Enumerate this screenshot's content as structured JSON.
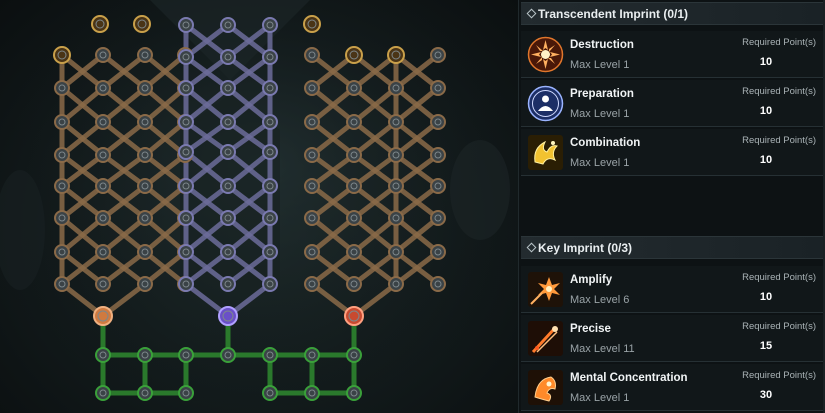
{
  "colors": {
    "orange_branch": "#8a6a48",
    "purple_branch": "#6c6c9a",
    "green_branch": "#2f8a2f",
    "node_fill": "#3a4246",
    "panel_bg": "#0d1214"
  },
  "tree": {
    "description_icons": [
      "node-orange-icon",
      "node-purple-icon",
      "node-green-icon"
    ]
  },
  "transcendent": {
    "title": "Transcendent Imprint (0/1)",
    "items": [
      {
        "name": "Destruction",
        "level": "Max Level 1",
        "req_label": "Required Point(s)",
        "points": "10",
        "icon": "destruction-icon"
      },
      {
        "name": "Preparation",
        "level": "Max Level 1",
        "req_label": "Required Point(s)",
        "points": "10",
        "icon": "preparation-icon"
      },
      {
        "name": "Combination",
        "level": "Max Level 1",
        "req_label": "Required Point(s)",
        "points": "10",
        "icon": "combination-icon"
      }
    ]
  },
  "key": {
    "title": "Key Imprint (0/3)",
    "items": [
      {
        "name": "Amplify",
        "level": "Max Level 6",
        "req_label": "Required Point(s)",
        "points": "10",
        "icon": "amplify-icon"
      },
      {
        "name": "Precise",
        "level": "Max Level 11",
        "req_label": "Required Point(s)",
        "points": "15",
        "icon": "precise-icon"
      },
      {
        "name": "Mental Concentration",
        "level": "Max Level 1",
        "req_label": "Required Point(s)",
        "points": "30",
        "icon": "mental-concentration-icon"
      }
    ]
  }
}
